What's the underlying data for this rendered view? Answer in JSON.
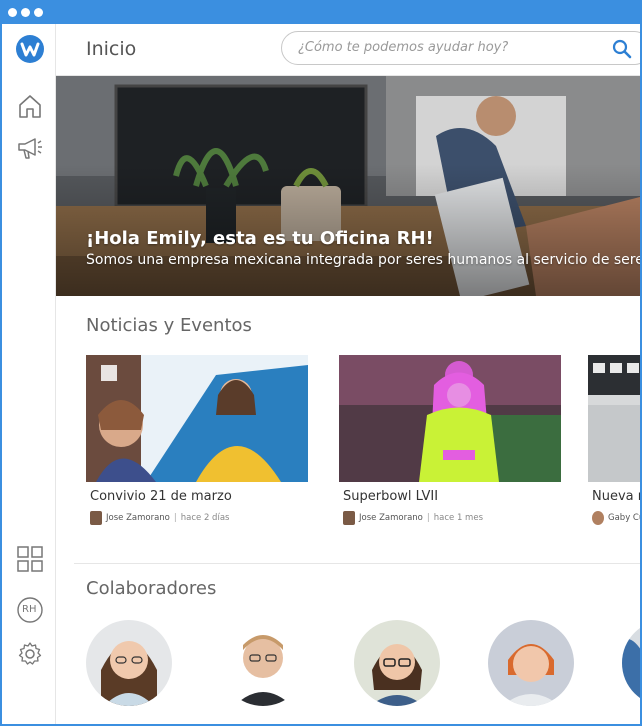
{
  "window": {
    "titlebar_color": "#3b8fe0"
  },
  "sidebar": {
    "logo_icon": "brand-logo-icon",
    "items": [
      {
        "name": "home-icon"
      },
      {
        "name": "megaphone-icon"
      },
      {
        "name": "grid-icon"
      },
      {
        "name": "rh-icon",
        "label": "RH"
      },
      {
        "name": "gear-icon"
      }
    ]
  },
  "header": {
    "title": "Inicio",
    "search_placeholder": "¿Cómo te podemos ayudar hoy?"
  },
  "hero": {
    "title": "¡Hola Emily, esta es tu Oficina RH!",
    "subtitle": "Somos una empresa mexicana integrada por seres humanos al servicio de seres"
  },
  "news": {
    "title": "Noticias y Eventos",
    "cards": [
      {
        "title": "Convivio 21 de marzo",
        "author": "Jose Zamorano",
        "time": "hace 2 días"
      },
      {
        "title": "Superbowl LVII",
        "author": "Jose Zamorano",
        "time": "hace 1 mes"
      },
      {
        "title": "Nueva re",
        "author": "Gaby Cue",
        "time": ""
      }
    ]
  },
  "collaborators": {
    "title": "Colaboradores",
    "count_visible": 5
  },
  "colors": {
    "accent": "#2d7fd3",
    "text": "#555555"
  }
}
